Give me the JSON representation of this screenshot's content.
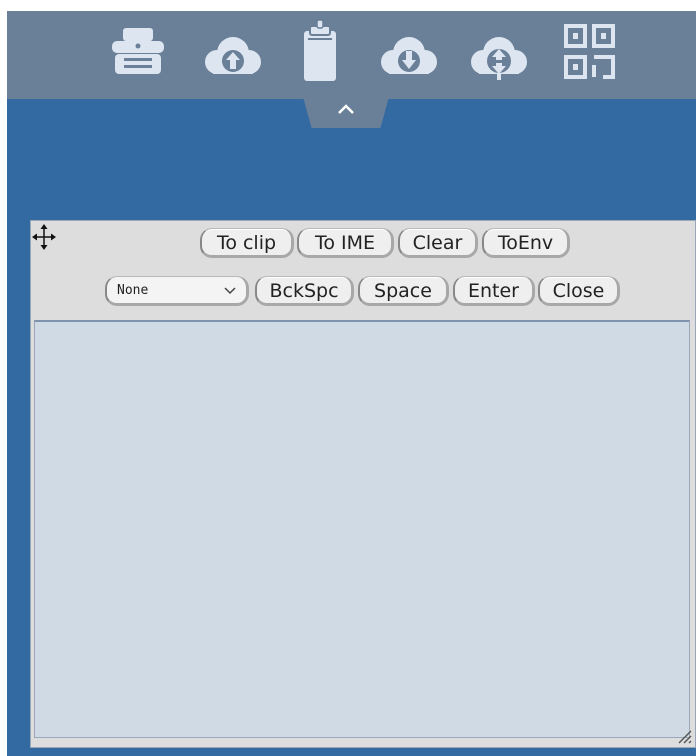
{
  "colors": {
    "toolbar": "#6a7f98",
    "background": "#336aa2",
    "panel": "#dddddd",
    "text_area": "#d0dae4"
  },
  "toolbar": {
    "icons": [
      "printer-icon",
      "cloud-upload-icon",
      "clipboard-icon",
      "cloud-download-icon",
      "cloud-sync-icon",
      "qr-code-icon"
    ]
  },
  "panel": {
    "buttons_row1": {
      "to_clip": "To clip",
      "to_ime": "To IME",
      "clear": "Clear",
      "to_env": "ToEnv"
    },
    "select": {
      "value": "None"
    },
    "buttons_row2": {
      "backspace": "BckSpc",
      "space": "Space",
      "enter": "Enter",
      "close": "Close"
    },
    "text_area_value": ""
  }
}
